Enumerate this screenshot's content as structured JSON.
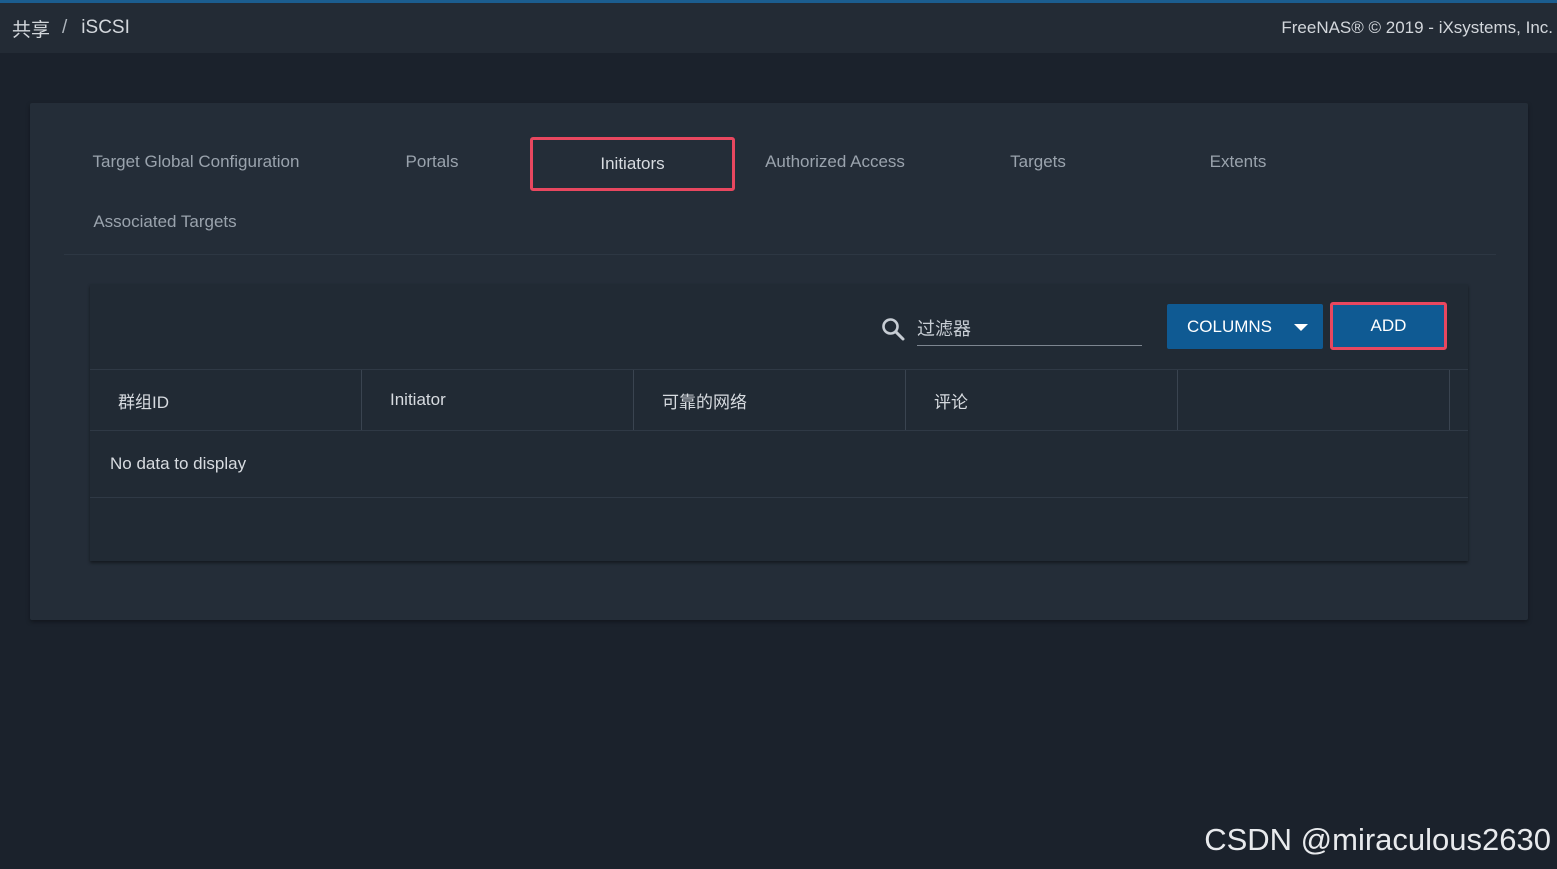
{
  "header": {
    "breadcrumb": [
      "共享",
      "iSCSI"
    ],
    "separator": "/",
    "copyright": "FreeNAS® © 2019 - iXsystems, Inc."
  },
  "tabs": [
    {
      "label": "Target Global Configuration",
      "active": false
    },
    {
      "label": "Portals",
      "active": false
    },
    {
      "label": "Initiators",
      "active": true
    },
    {
      "label": "Authorized Access",
      "active": false
    },
    {
      "label": "Targets",
      "active": false
    },
    {
      "label": "Extents",
      "active": false
    },
    {
      "label": "Associated Targets",
      "active": false
    }
  ],
  "toolbar": {
    "filter_placeholder": "过滤器",
    "columns_label": "COLUMNS",
    "add_label": "ADD"
  },
  "table": {
    "columns": [
      "群组ID",
      "Initiator",
      "可靠的网络",
      "评论",
      ""
    ],
    "empty_message": "No data to display"
  },
  "watermark": "CSDN @miraculous2630",
  "colors": {
    "accent": "#0f5a93",
    "highlight": "#e8475f",
    "background": "#1b222c"
  }
}
